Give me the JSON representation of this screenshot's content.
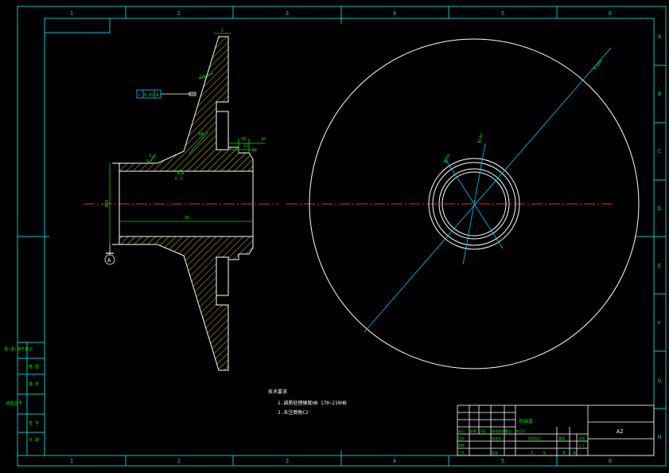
{
  "frame": {
    "col_labels": [
      "1",
      "2",
      "3",
      "4",
      "5",
      "6"
    ],
    "row_labels": [
      "A",
      "B",
      "C",
      "D",
      "E",
      "F",
      "G",
      "H"
    ]
  },
  "side_block": {
    "labels": [
      "借(通)用件登记",
      "描  图",
      "描  校",
      "底图总号",
      "签  字",
      "日  期"
    ]
  },
  "dimensions": {
    "top_width": "5",
    "upper_small": "2/1",
    "section": "R8",
    "step_a": "30",
    "step_b": "10",
    "step_c": "12",
    "step_d": "12",
    "roughness_left": "3.2",
    "roughness_bottom": "6.3",
    "bore_dia": "Φ50",
    "length": "90",
    "circle_large_dia": "Φ1000",
    "circle_hub_a": "Φ300",
    "circle_hub_b": "Φ240"
  },
  "tolerance_box": {
    "symbol": "↗",
    "value": "0.05",
    "datum": "A"
  },
  "datum_label": "A",
  "tech_requirements": {
    "title": "技术要求",
    "items": [
      "1.调质处理硬度HB 170~210HB",
      "2.未注倒角C2"
    ]
  },
  "title_block": {
    "part_name": "后端盖",
    "sheet_size": "A2",
    "cells": [
      "标记",
      "处数",
      "分区",
      "更改文件号",
      "签名",
      "年月日",
      "设计",
      "标准化",
      "阶段标记",
      "重量",
      "比例",
      "审核",
      "工艺",
      "批准",
      "共",
      "张",
      "第",
      "张",
      "1:1"
    ]
  },
  "colors": {
    "frame": "#00c8c8",
    "outline": "#ffffff",
    "dimension": "#00e000",
    "hatch": "#d6c81a",
    "centerline": "#ff2020",
    "leader": "#00c8ff"
  }
}
